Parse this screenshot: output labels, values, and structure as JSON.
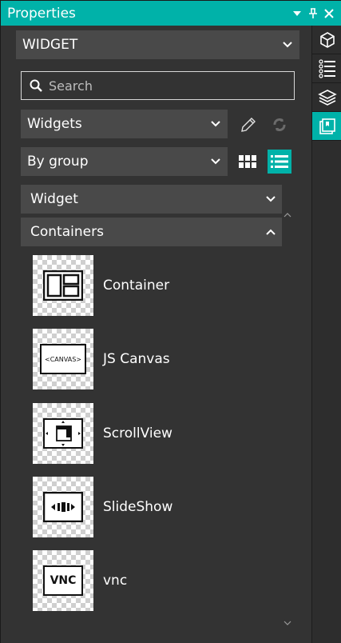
{
  "window": {
    "title": "Properties"
  },
  "title_buttons": {
    "dropdown": "▾",
    "pin": "⊥",
    "close": "✕"
  },
  "widget_selector": {
    "value": "WIDGET"
  },
  "search": {
    "placeholder": "Search"
  },
  "library_selector": {
    "value": "Widgets"
  },
  "sort_selector": {
    "value": "By group"
  },
  "groups": [
    {
      "label": "Widget",
      "expanded": false
    },
    {
      "label": "Containers",
      "expanded": true
    }
  ],
  "items": [
    {
      "label": "Container",
      "icon": "container-icon"
    },
    {
      "label": "JS Canvas",
      "icon": "canvas-icon",
      "thumb_text": "<CANVAS>"
    },
    {
      "label": "ScrollView",
      "icon": "scrollview-icon"
    },
    {
      "label": "SlideShow",
      "icon": "slideshow-icon"
    },
    {
      "label": "vnc",
      "icon": "vnc-icon",
      "thumb_text": "VNC"
    }
  ],
  "right_toolbar": [
    {
      "icon": "cube-icon",
      "active": false
    },
    {
      "icon": "list-icon",
      "active": false
    },
    {
      "icon": "layers-icon",
      "active": false
    },
    {
      "icon": "widget-library-icon",
      "active": true
    }
  ],
  "colors": {
    "accent": "#00b2a9",
    "panel": "#333333",
    "control": "#494949"
  }
}
